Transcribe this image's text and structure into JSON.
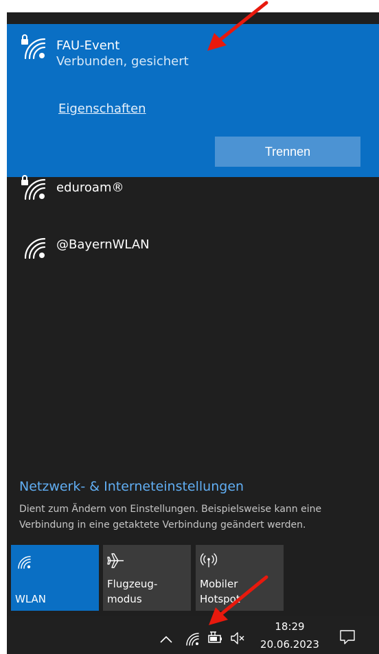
{
  "connected_network": {
    "name": "FAU-Event",
    "status": "Verbunden, gesichert",
    "properties_label": "Eigenschaften",
    "disconnect_label": "Trennen",
    "secured": true
  },
  "networks": [
    {
      "name": "eduroam®",
      "secured": true
    },
    {
      "name": "@BayernWLAN",
      "secured": false
    }
  ],
  "settings": {
    "link_label": "Netzwerk- & Interneteinstellungen",
    "description": "Dient zum Ändern von Einstellungen. Beispielsweise kann eine Verbindung in eine getaktete Verbindung geändert werden."
  },
  "quick_actions": [
    {
      "label": "WLAN",
      "icon": "wifi-icon",
      "active": true
    },
    {
      "label": "Flugzeug-\nmodus",
      "icon": "airplane-icon",
      "active": false
    },
    {
      "label": "Mobiler\nHotspot",
      "icon": "hotspot-icon",
      "active": false
    }
  ],
  "taskbar": {
    "time": "18:29",
    "date": "20.06.2023",
    "icons": [
      "chevron-up-icon",
      "wifi-icon",
      "battery-icon",
      "speaker-muted-icon",
      "notification-icon"
    ]
  },
  "colors": {
    "panel_bg": "#1f1f1f",
    "connected_bg": "#0a6fc4",
    "button_bg": "#4c93d3",
    "tile_active": "#0a6fc4",
    "tile_inactive": "#3b3b3b",
    "link": "#61aef3",
    "annotation_arrow": "#e8190d"
  }
}
